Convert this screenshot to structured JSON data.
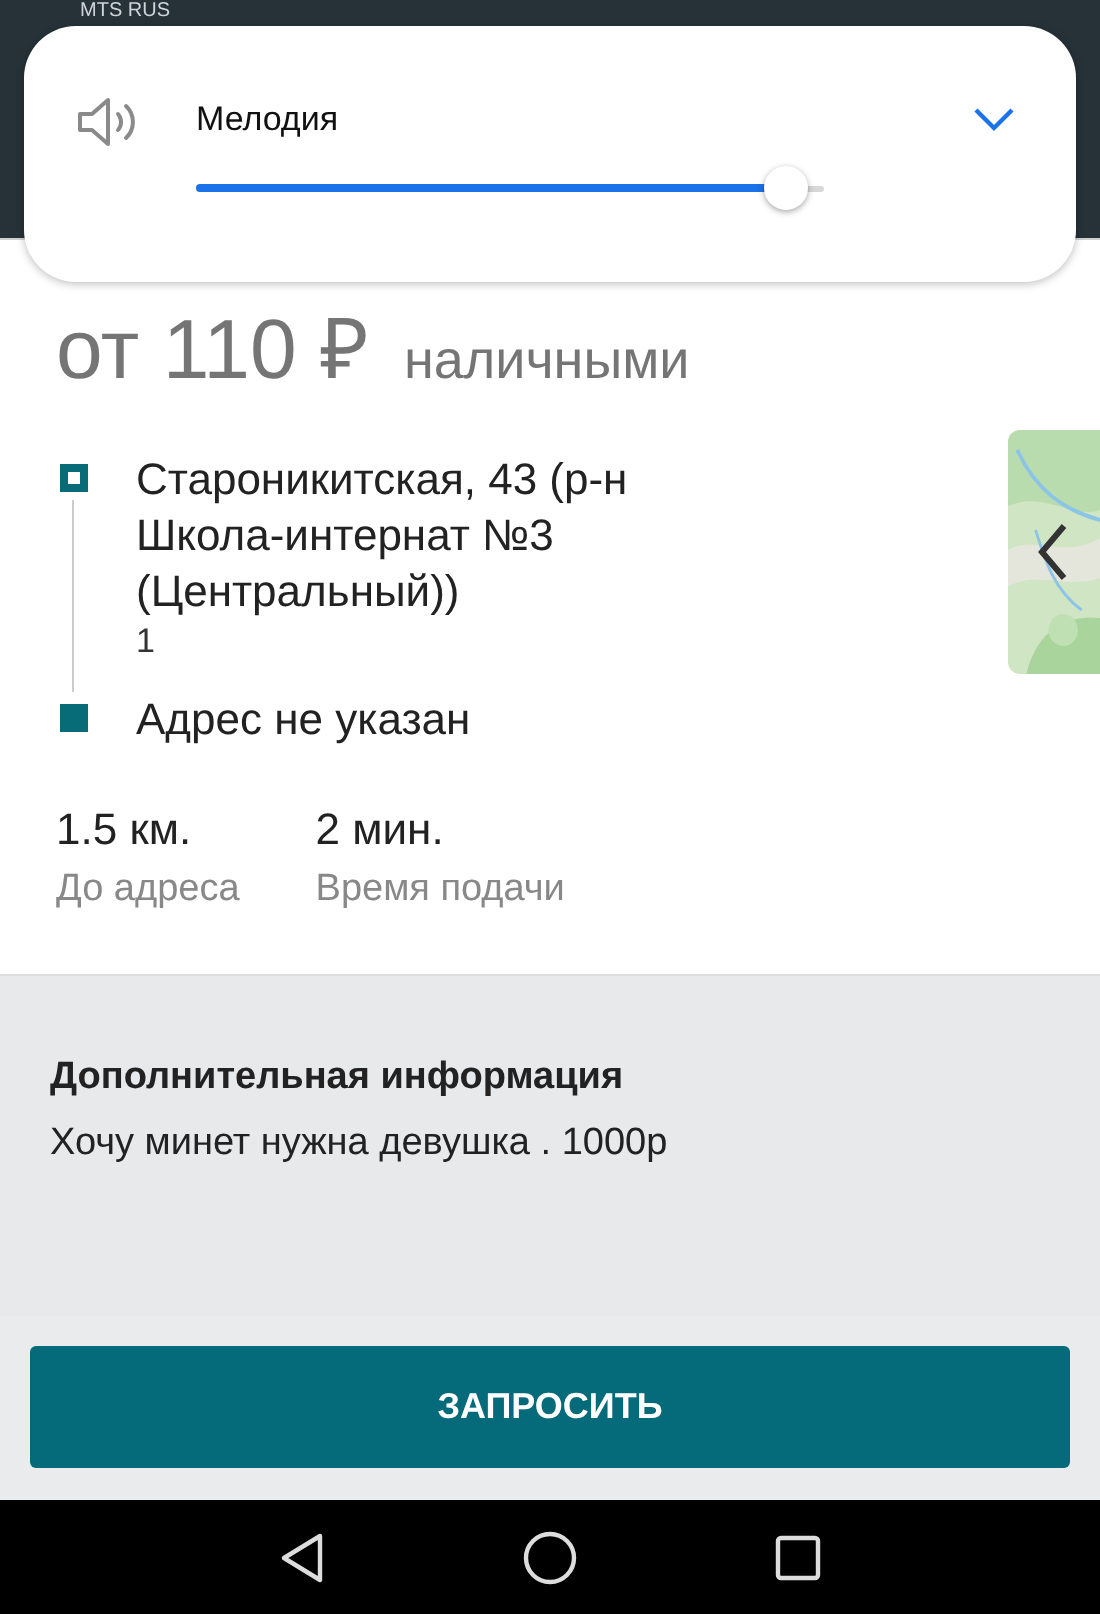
{
  "status_bar": {
    "carrier": "MTS RUS"
  },
  "volume_panel": {
    "label": "Мелодия",
    "level": 0.94
  },
  "price": {
    "amount": "от 110 ₽",
    "payment": "наличными"
  },
  "route": {
    "points": [
      {
        "kind": "pickup",
        "address": "Староникитская, 43 (р-н Школа-интернат №3 (Центральный))",
        "detail": "1"
      },
      {
        "kind": "dropoff",
        "address": "Адрес не указан"
      }
    ]
  },
  "stats": [
    {
      "value": "1.5 км.",
      "label": "До адреса"
    },
    {
      "value": "2 мин.",
      "label": "Время подачи"
    }
  ],
  "additional_info": {
    "title": "Дополнительная информация",
    "text": "Хочу минет нужна девушка . 1000р"
  },
  "request_button": {
    "label": "ЗАПРОСИТЬ"
  }
}
